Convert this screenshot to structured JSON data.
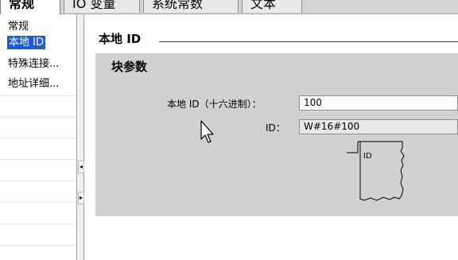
{
  "tabs": [
    {
      "label": "常规",
      "active": true
    },
    {
      "label": "IO 变量",
      "active": false
    },
    {
      "label": "系统常数",
      "active": false
    },
    {
      "label": "文本",
      "active": false
    }
  ],
  "nav": {
    "items": [
      {
        "label": "常规",
        "selected": false
      },
      {
        "label": "本地 ID",
        "selected": true
      },
      {
        "label": "特殊连接...",
        "selected": false
      },
      {
        "label": "地址详细...",
        "selected": false
      }
    ]
  },
  "splitter": {
    "collapse_left": "◂",
    "expand_right": "▸"
  },
  "section": {
    "title": "本地 ID"
  },
  "block_params": {
    "title": "块参数",
    "local_id_hex_label": "本地 ID（十六进制）：",
    "local_id_hex_value": "100",
    "id_label": "ID：",
    "id_value": "W#16#100",
    "block_port_label": "ID"
  },
  "colors": {
    "selected": "#1f5bd6",
    "panel": "#d1d1d1"
  }
}
